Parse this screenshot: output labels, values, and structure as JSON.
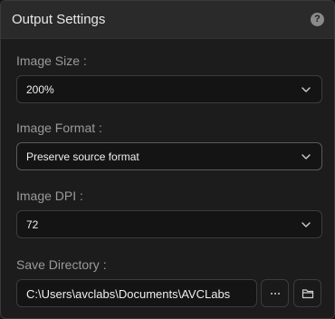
{
  "header": {
    "title": "Output Settings",
    "help_glyph": "?"
  },
  "image_size": {
    "label": "Image Size :",
    "value": "200%"
  },
  "image_format": {
    "label": "Image Format :",
    "value": "Preserve source format"
  },
  "image_dpi": {
    "label": "Image DPI :",
    "value": "72"
  },
  "save_directory": {
    "label": "Save Directory :",
    "value": "C:\\Users\\avclabs\\Documents\\AVCLabs"
  },
  "icons": {
    "help": "help-icon",
    "dropdown": "chevron-down-icon",
    "browse": "more-icon",
    "open_folder": "folder-icon"
  },
  "colors": {
    "background": "#1c1c1c",
    "header": "#2a2a2a",
    "text": "#eeeeee",
    "label": "#9a9a9a"
  }
}
